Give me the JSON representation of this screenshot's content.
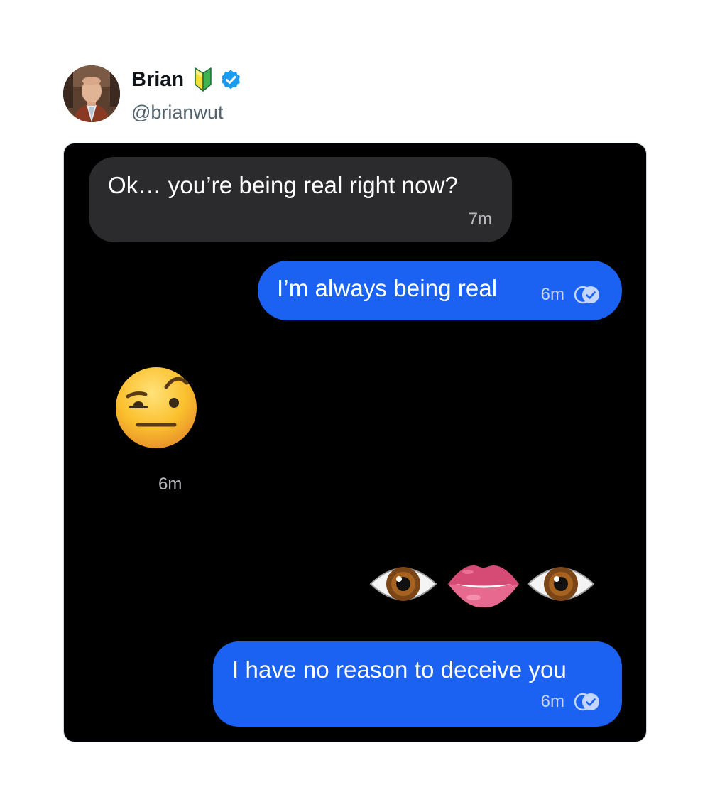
{
  "tweet": {
    "author": {
      "display_name": "Brian",
      "handle": "@brianwut",
      "badge_icon": "beginner-icon",
      "verified_icon": "verified-icon",
      "verified_color": "#1d9bf0"
    }
  },
  "chat": {
    "colors": {
      "background": "#000000",
      "incoming_bubble": "#2b2b2e",
      "outgoing_bubble": "#1b61f2"
    },
    "messages": [
      {
        "direction": "incoming",
        "text": "Ok… you’re being real right now?",
        "time": "7m"
      },
      {
        "direction": "outgoing",
        "text": "I’m always being real",
        "time": "6m",
        "status_icon": "read-receipt-icon"
      },
      {
        "direction": "incoming",
        "emoji": "face-with-raised-eyebrow",
        "time": "6m"
      },
      {
        "direction": "outgoing",
        "emoji": [
          "eye",
          "mouth",
          "eye"
        ]
      },
      {
        "direction": "outgoing",
        "text": "I have no reason to deceive you",
        "time": "6m",
        "status_icon": "read-receipt-icon"
      }
    ]
  }
}
